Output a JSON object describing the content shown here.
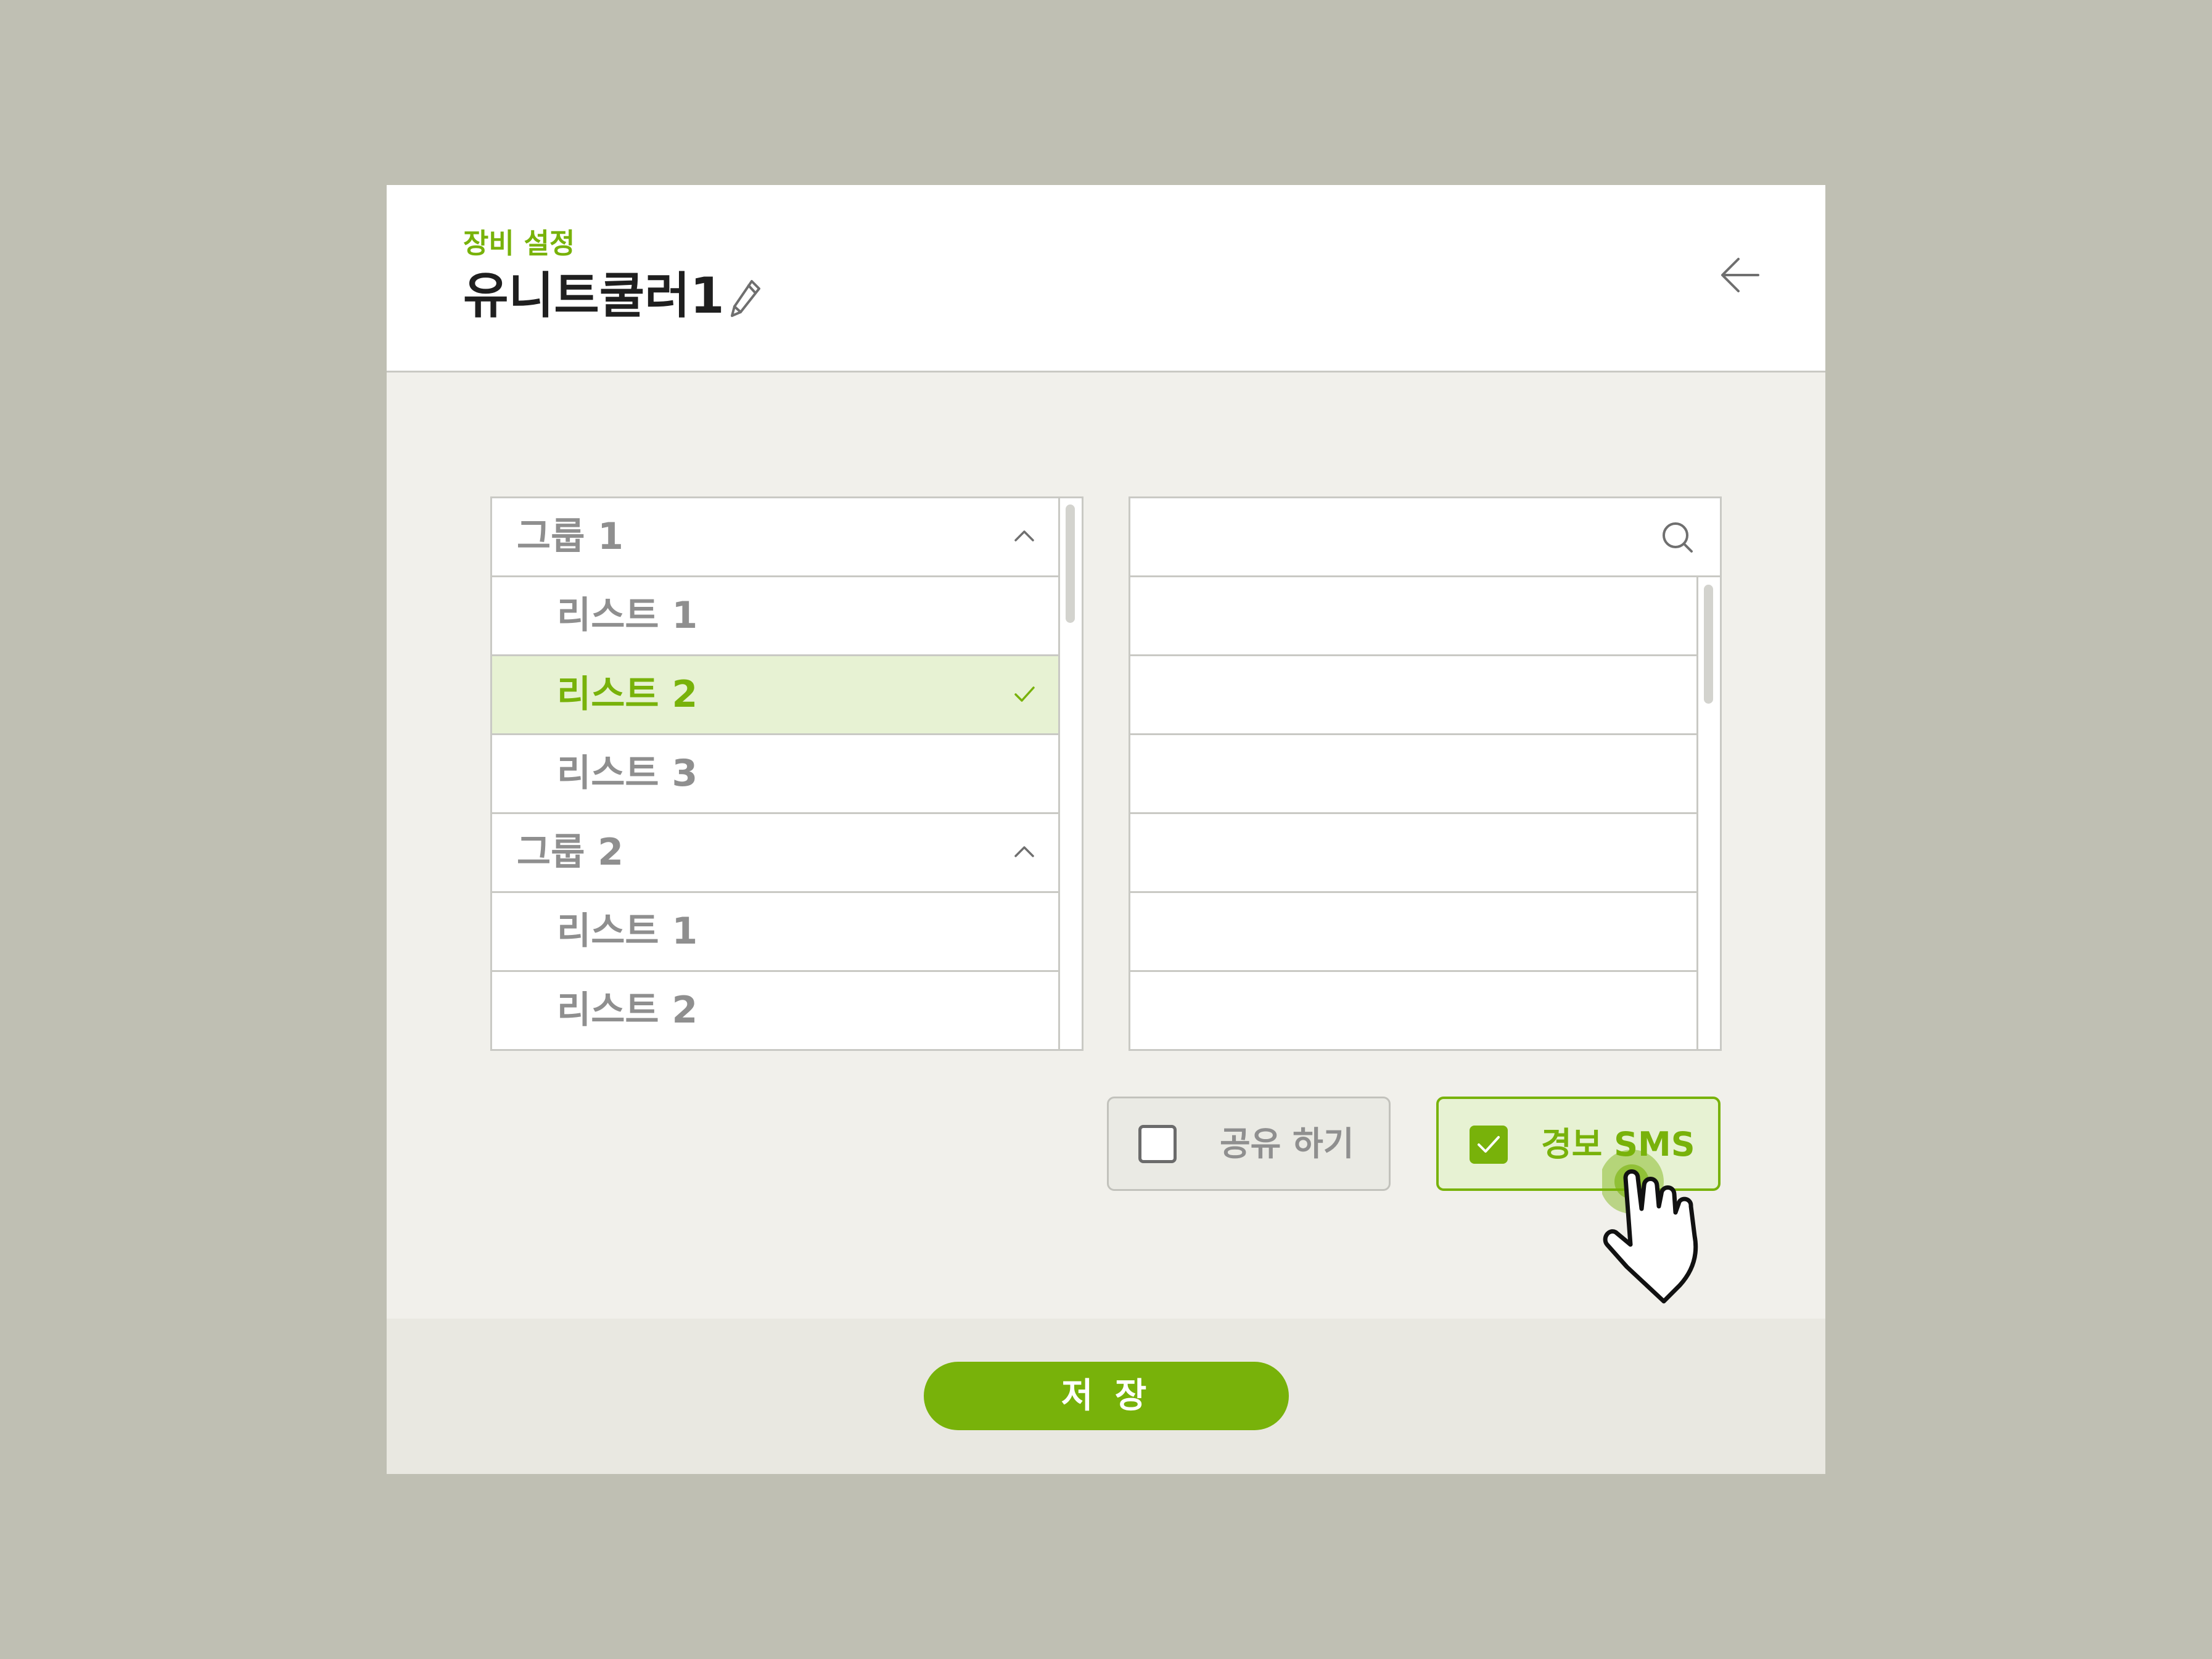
{
  "header": {
    "subtitle": "장비 설정",
    "title": "유니트쿨러1",
    "edit_icon": "pencil-icon",
    "back_icon": "arrow-left-icon"
  },
  "group_list": {
    "rows": [
      {
        "type": "group",
        "label": "그룹 1",
        "icon": "chevron-up-icon"
      },
      {
        "type": "item",
        "label": "리스트 1"
      },
      {
        "type": "item",
        "label": "리스트 2",
        "selected": true,
        "icon": "check-icon"
      },
      {
        "type": "item",
        "label": "리스트 3"
      },
      {
        "type": "group",
        "label": "그룹 2",
        "icon": "chevron-up-icon"
      },
      {
        "type": "item",
        "label": "리스트 1"
      },
      {
        "type": "item",
        "label": "리스트 2"
      }
    ]
  },
  "search_list": {
    "search_value": "",
    "search_icon": "search-icon",
    "rows": [
      "",
      "",
      "",
      "",
      "",
      ""
    ]
  },
  "options": {
    "share": {
      "label": "공유 하기",
      "checked": false
    },
    "sms": {
      "label": "경보 SMS",
      "checked": true
    }
  },
  "footer": {
    "save_label": "저 장"
  },
  "colors": {
    "accent": "#78b20a",
    "selected_bg": "#e7f2d3",
    "backdrop": "#bfbfb3",
    "body_bg": "#f1f0eb"
  }
}
